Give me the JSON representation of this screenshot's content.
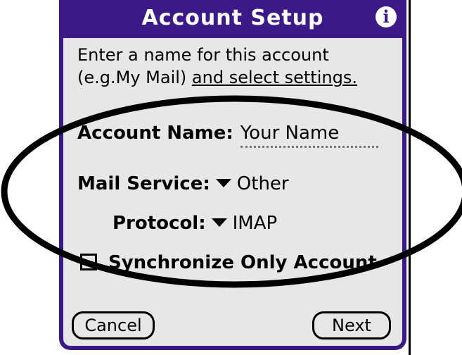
{
  "dialog": {
    "title": "Account Setup",
    "info_icon": "info-icon",
    "intro_line1": "Enter a name for this account",
    "intro_line2_prefix": "(e.g.My Mail) ",
    "intro_line2_link": "and select settings.",
    "account_name_label": "Account Name:",
    "account_name_value": "Your Name",
    "mail_service_label": "Mail Service:",
    "mail_service_value": "Other",
    "protocol_label": "Protocol:",
    "protocol_value": "IMAP",
    "sync_label": "Synchronize Only Account",
    "sync_checked": false,
    "cancel_label": "Cancel",
    "next_label": "Next"
  },
  "colors": {
    "accent": "#3b1a87",
    "dialog_bg": "#e7e7e7"
  }
}
